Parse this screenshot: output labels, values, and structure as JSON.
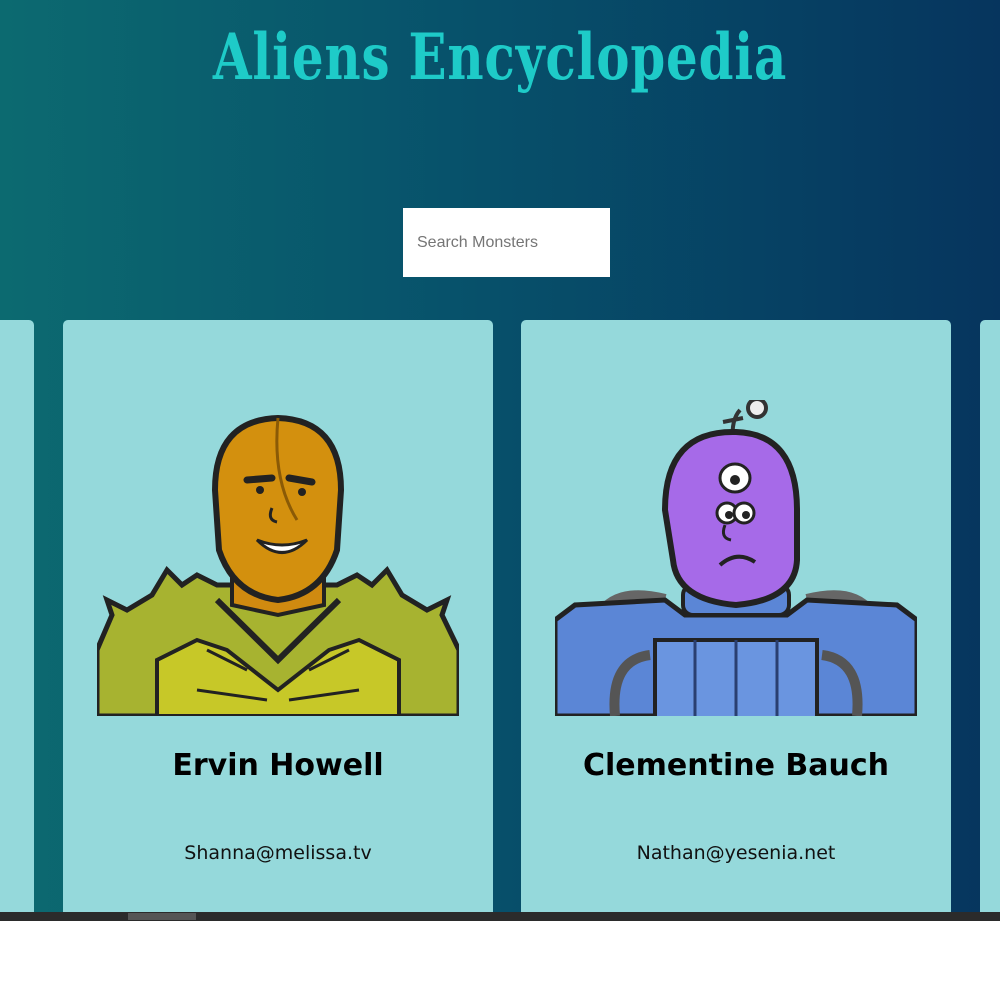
{
  "header": {
    "title": "Aliens Encyclopedia"
  },
  "search": {
    "placeholder": "Search Monsters",
    "value": ""
  },
  "cards": [
    {
      "name": "Ervin Howell",
      "email": "Shanna@melissa.tv",
      "avatar_icon": "yellow-armored-alien-icon"
    },
    {
      "name": "Clementine Bauch",
      "email": "Nathan@yesenia.net",
      "avatar_icon": "purple-robot-alien-icon"
    }
  ],
  "colors": {
    "title": "#1ecbc8",
    "card_background": "#95d9db",
    "gradient_left": "#0c6a70",
    "gradient_right": "#06355e"
  }
}
